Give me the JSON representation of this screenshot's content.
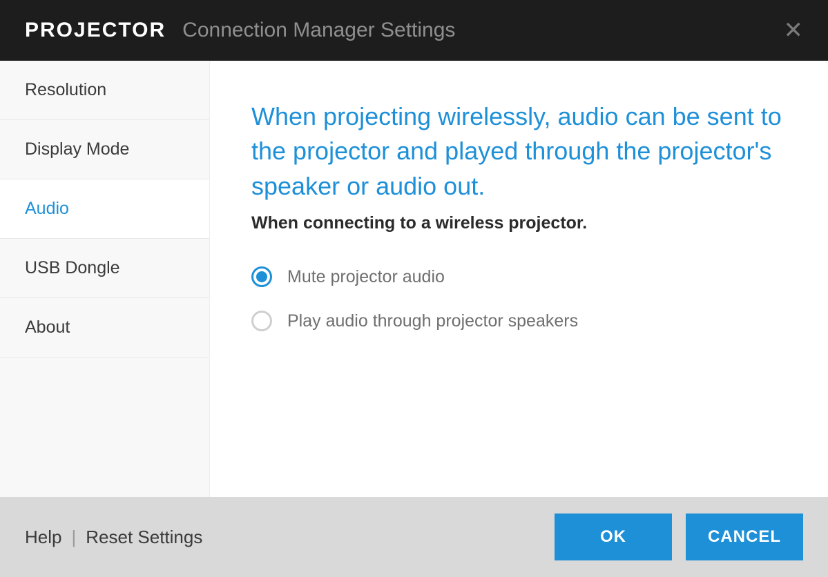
{
  "header": {
    "brand": "PROJECTOR",
    "subtitle": "Connection Manager Settings"
  },
  "sidebar": {
    "items": [
      {
        "label": "Resolution",
        "active": false
      },
      {
        "label": "Display Mode",
        "active": false
      },
      {
        "label": "Audio",
        "active": true
      },
      {
        "label": "USB Dongle",
        "active": false
      },
      {
        "label": "About",
        "active": false
      }
    ]
  },
  "main": {
    "intro": "When projecting wirelessly, audio can be sent to the projector and played through the projector's speaker or audio out.",
    "subtitle": "When connecting to a wireless projector.",
    "options": [
      {
        "label": "Mute projector audio",
        "selected": true
      },
      {
        "label": "Play audio through projector speakers",
        "selected": false
      }
    ]
  },
  "footer": {
    "help_label": "Help",
    "reset_label": "Reset Settings",
    "ok_label": "OK",
    "cancel_label": "CANCEL"
  }
}
